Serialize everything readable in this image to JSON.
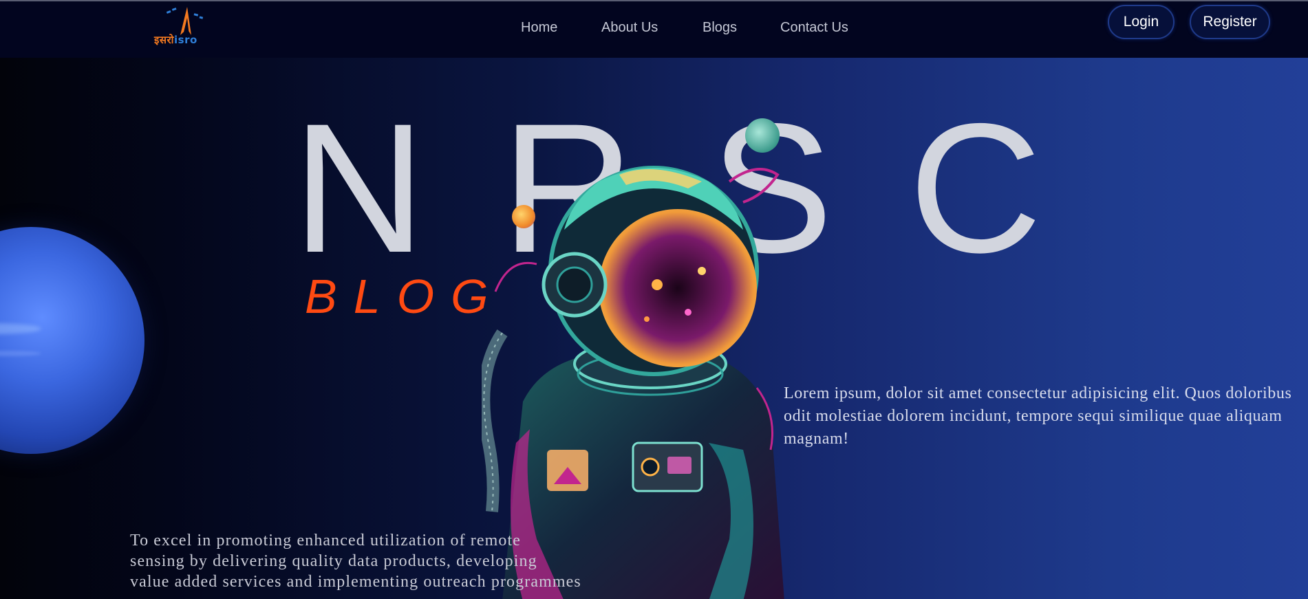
{
  "brand": {
    "logo_text_hindi": "इसरो",
    "logo_text_latin": "isro"
  },
  "nav": {
    "links": [
      {
        "label": "Home"
      },
      {
        "label": "About Us"
      },
      {
        "label": "Blogs"
      },
      {
        "label": "Contact Us"
      }
    ],
    "login_label": "Login",
    "register_label": "Register"
  },
  "hero": {
    "title": "NRSC",
    "subtitle": "BLOG",
    "description": "Lorem ipsum, dolor sit amet consectetur adipisicing elit. Quos doloribus odit molestiae dolorem incidunt, tempore sequi similique quae aliquam magnam!",
    "mission_line1": "To excel in promoting enhanced utilization of remote",
    "mission_line2": "sensing by delivering quality data products, developing",
    "mission_line3": "value added services and implementing outreach programmes"
  },
  "colors": {
    "accent": "#ff4a12",
    "nav_background": "#02051f",
    "title": "#d2d5de",
    "button_border": "#1f3a8a"
  },
  "icons": {
    "logo": "isro-rocket-logo",
    "hero_image": "astronaut-illustration",
    "planet": "neptune-planet"
  }
}
